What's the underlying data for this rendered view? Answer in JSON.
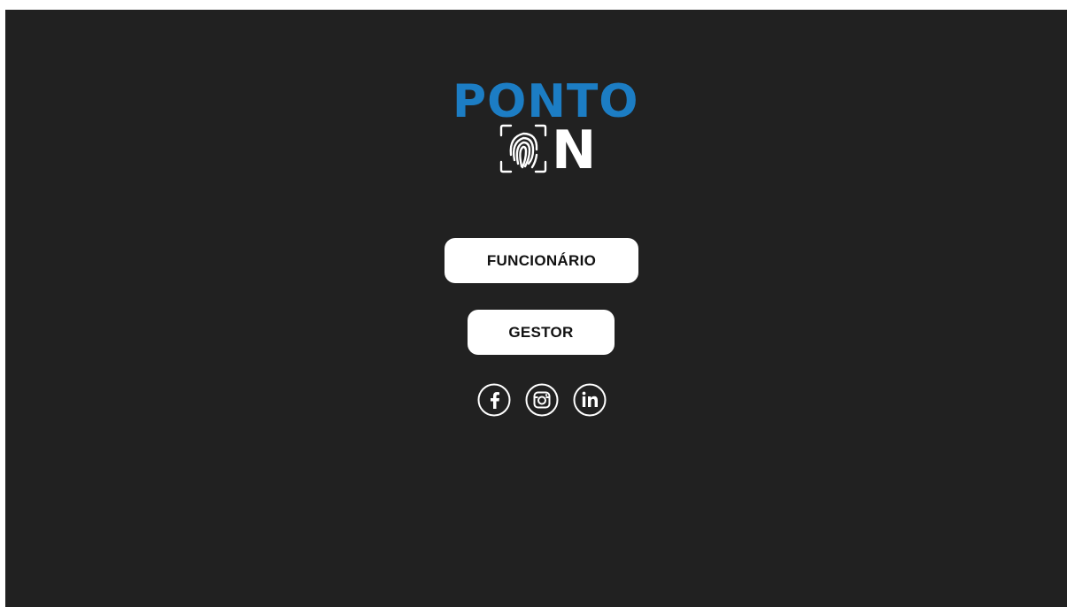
{
  "logo": {
    "top_text": "PONTO",
    "bottom_letter": "N",
    "icon": "fingerprint-icon",
    "colors": {
      "primary": "#1c7dc4",
      "secondary": "#ffffff"
    }
  },
  "buttons": {
    "employee_label": "FUNCIONÁRIO",
    "manager_label": "GESTOR"
  },
  "social": [
    {
      "icon": "facebook-icon"
    },
    {
      "icon": "instagram-icon"
    },
    {
      "icon": "linkedin-icon"
    }
  ],
  "theme": {
    "background": "#212121",
    "button_bg": "#ffffff",
    "button_text": "#111111"
  }
}
